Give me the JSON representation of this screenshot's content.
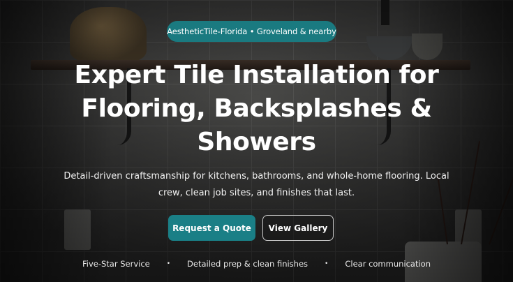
{
  "hero": {
    "badge": "AestheticTile-Florida • Groveland & nearby",
    "headline": "Expert Tile Installation for Flooring, Backsplashes & Showers",
    "subtext": "Detail-driven craftsmanship for kitchens, bathrooms, and whole-home flooring. Local crew, clean job sites, and finishes that last.",
    "primary_cta": "Request a Quote",
    "secondary_cta": "View Gallery",
    "features": [
      "Five-Star Service",
      "Detailed prep & clean finishes",
      "Clear communication"
    ],
    "feature_separator": "•"
  },
  "colors": {
    "accent": "#1a7f86",
    "text": "#ffffff",
    "overlay": "#1d1d1d"
  }
}
